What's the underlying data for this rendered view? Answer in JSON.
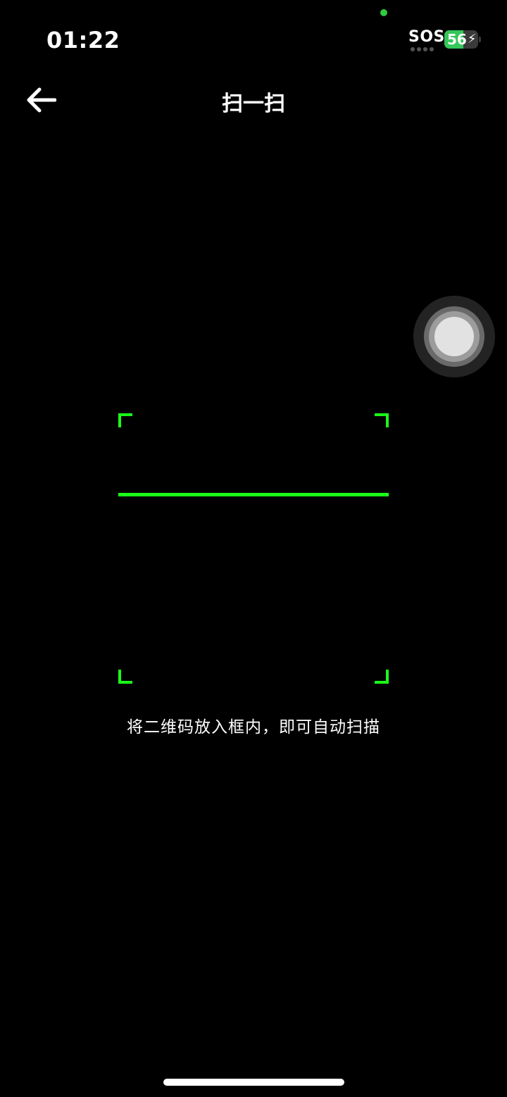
{
  "status_bar": {
    "time": "01:22",
    "carrier": "SOS",
    "battery_percent": "56",
    "battery_level": 0.56,
    "battery_charging_icon": "bolt-icon",
    "privacy_indicator_color": "#2ecc40"
  },
  "nav": {
    "back_icon": "arrow-left-icon",
    "title": "扫一扫"
  },
  "scanner": {
    "accent_color": "#1aff1a",
    "hint": "将二维码放入框内，即可自动扫描"
  },
  "assistive_touch": {
    "icon": "assistive-touch-icon"
  }
}
